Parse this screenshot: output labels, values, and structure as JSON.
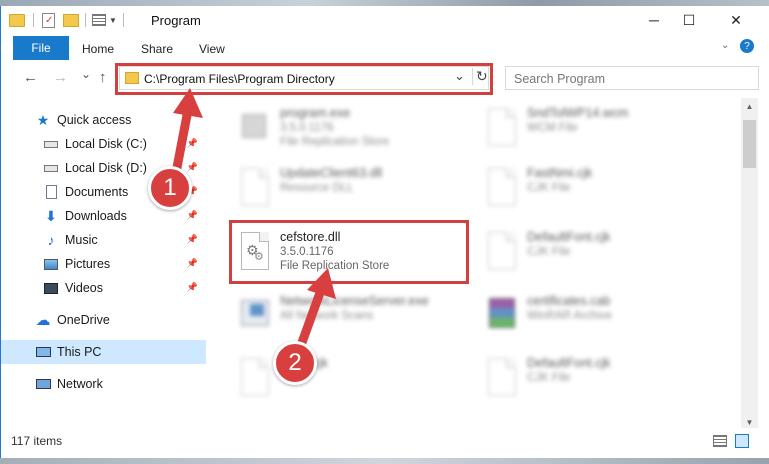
{
  "window": {
    "title": "Program",
    "controls": {
      "minimize": "─",
      "maximize": "☐",
      "close": "✕"
    }
  },
  "ribbon": {
    "tabs": [
      {
        "label": "File",
        "active": true
      },
      {
        "label": "Home"
      },
      {
        "label": "Share"
      },
      {
        "label": "View"
      }
    ]
  },
  "navigation": {
    "back": "←",
    "forward": "→",
    "recent": "⌄",
    "up": "↑",
    "address": "C:\\Program Files\\Program Directory",
    "refresh": "↻",
    "dropdown": "⌄",
    "search_placeholder": "Search Program"
  },
  "sidebar": {
    "items": [
      {
        "label": "Quick access",
        "icon": "star-icon",
        "pinned": false
      },
      {
        "label": "Local Disk (C:)",
        "icon": "drive-icon",
        "pinned": true
      },
      {
        "label": "Local Disk (D:)",
        "icon": "drive-icon",
        "pinned": true
      },
      {
        "label": "Documents",
        "icon": "documents-icon",
        "pinned": true
      },
      {
        "label": "Downloads",
        "icon": "download-icon",
        "pinned": true
      },
      {
        "label": "Music",
        "icon": "music-icon",
        "pinned": true
      },
      {
        "label": "Pictures",
        "icon": "pictures-icon",
        "pinned": true
      },
      {
        "label": "Videos",
        "icon": "videos-icon",
        "pinned": true
      },
      {
        "label": "OneDrive",
        "icon": "cloud-icon",
        "pinned": false
      },
      {
        "label": "This PC",
        "icon": "computer-icon",
        "pinned": false,
        "selected": true
      },
      {
        "label": "Network",
        "icon": "network-icon",
        "pinned": false
      }
    ]
  },
  "files": [
    {
      "name": "program.exe",
      "line1": "3.5.0.1176",
      "line2": "File Replication Store",
      "blurred": true
    },
    {
      "name": "SndTolWP14.wcm",
      "line1": "WCM File",
      "line2": "",
      "blurred": true
    },
    {
      "name": "UpdateClient63.dll",
      "line1": "Resource DLL",
      "line2": "",
      "blurred": true
    },
    {
      "name": "FastNmi.cjk",
      "line1": "CJK File",
      "line2": "",
      "blurred": true
    },
    {
      "name": "cefstore.dll",
      "line1": "3.5.0.1176",
      "line2": "File Replication Store",
      "blurred": false,
      "highlighted": true
    },
    {
      "name": "DefaultFont.cjk",
      "line1": "CJK File",
      "line2": "",
      "blurred": true
    },
    {
      "name": "NetworkLicenseServer.exe",
      "line1": "All Network Scans",
      "line2": "",
      "blurred": true
    },
    {
      "name": "certificates.cab",
      "line1": "WinRAR Archive",
      "line2": "",
      "blurred": true
    },
    {
      "name": "Rnml.cjk",
      "line1": "",
      "line2": "",
      "blurred": true
    },
    {
      "name": "DefaultFont.cjk",
      "line1": "CJK File",
      "line2": "",
      "blurred": true
    }
  ],
  "status": {
    "item_count": "117 items"
  },
  "callouts": {
    "step1": "1",
    "step2": "2"
  },
  "colors": {
    "accent": "#1979ca",
    "highlight": "#d23f3f",
    "selection": "#cde8ff"
  }
}
